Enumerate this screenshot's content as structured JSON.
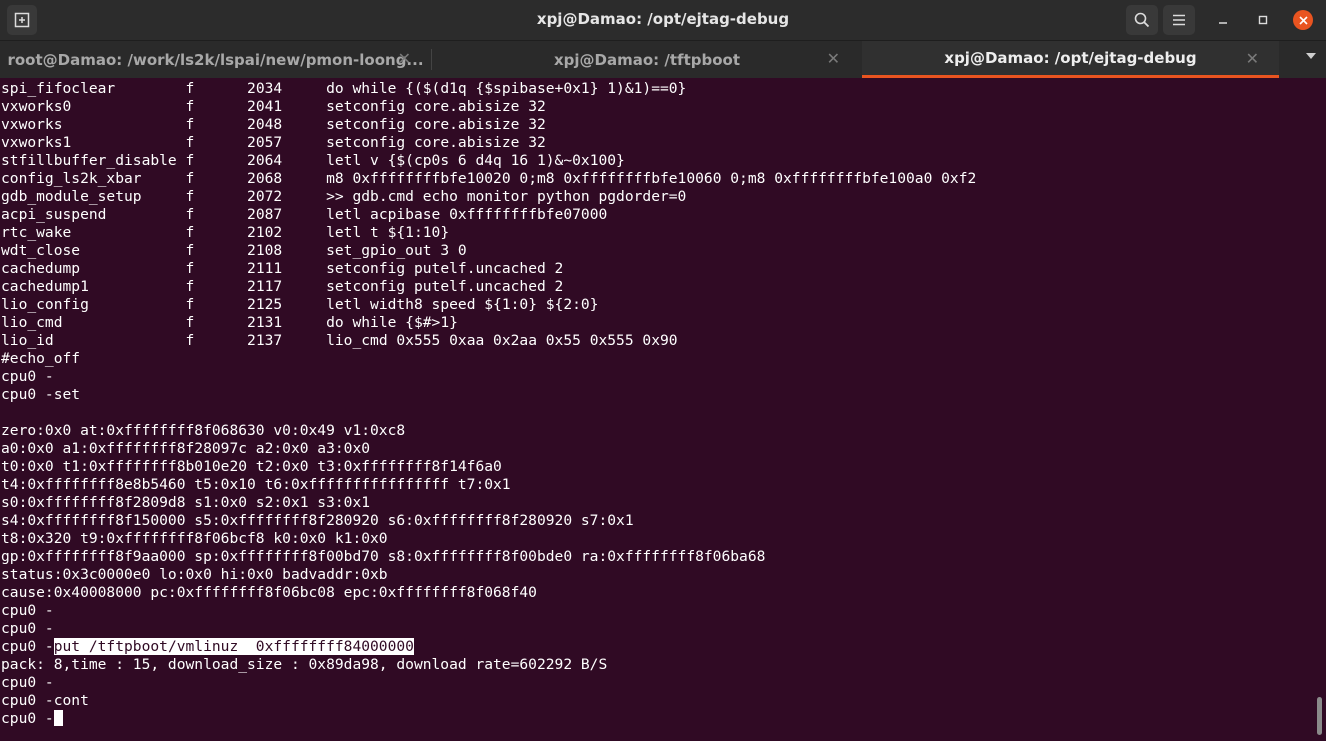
{
  "window": {
    "title": "xpj@Damao: /opt/ejtag-debug",
    "buttons": {
      "search": "search-icon",
      "menu": "hamburger-icon",
      "minimize": "minimize-icon",
      "maximize": "maximize-icon",
      "close": "close-icon"
    }
  },
  "tabs": [
    {
      "label": "root@Damao: /work/ls2k/lspai/new/pmon-loong...",
      "active": false
    },
    {
      "label": "xpj@Damao: /tftpboot",
      "active": false
    },
    {
      "label": "xpj@Damao: /opt/ejtag-debug",
      "active": true
    }
  ],
  "colors": {
    "terminal_bg": "#300a24",
    "accent": "#e95420",
    "titlebar": "#2c2c2c"
  },
  "terminal": {
    "table": [
      [
        "spi_fifoclear",
        "f",
        "2034",
        "do while {($(d1q {$spibase+0x1} 1)&1)==0}"
      ],
      [
        "vxworks0",
        "f",
        "2041",
        "setconfig core.abisize 32"
      ],
      [
        "vxworks",
        "f",
        "2048",
        "setconfig core.abisize 32"
      ],
      [
        "vxworks1",
        "f",
        "2057",
        "setconfig core.abisize 32"
      ],
      [
        "stfillbuffer_disable",
        "f",
        "2064",
        "letl v {$(cp0s 6 d4q 16 1)&~0x100}"
      ],
      [
        "config_ls2k_xbar",
        "f",
        "2068",
        "m8 0xffffffffbfe10020 0;m8 0xffffffffbfe10060 0;m8 0xffffffffbfe100a0 0xf2"
      ],
      [
        "gdb_module_setup",
        "f",
        "2072",
        ">> gdb.cmd echo monitor python pgdorder=0"
      ],
      [
        "acpi_suspend",
        "f",
        "2087",
        "letl acpibase 0xffffffffbfe07000"
      ],
      [
        "rtc_wake",
        "f",
        "2102",
        "letl t ${1:10}"
      ],
      [
        "wdt_close",
        "f",
        "2108",
        "set_gpio_out 3 0"
      ],
      [
        "cachedump",
        "f",
        "2111",
        "setconfig putelf.uncached 2"
      ],
      [
        "cachedump1",
        "f",
        "2117",
        "setconfig putelf.uncached 2"
      ],
      [
        "lio_config",
        "f",
        "2125",
        "letl width8 speed ${1:0} ${2:0}"
      ],
      [
        "lio_cmd",
        "f",
        "2131",
        "do while {$#>1}"
      ],
      [
        "lio_id",
        "f",
        "2137",
        "lio_cmd 0x555 0xaa 0x2aa 0x55 0x555 0x90"
      ]
    ],
    "lines_after_table": [
      "#echo_off",
      "cpu0 -",
      "cpu0 -set",
      "",
      "zero:0x0 at:0xffffffff8f068630 v0:0x49 v1:0xc8",
      "a0:0x0 a1:0xffffffff8f28097c a2:0x0 a3:0x0",
      "t0:0x0 t1:0xffffffff8b010e20 t2:0x0 t3:0xffffffff8f14f6a0",
      "t4:0xffffffff8e8b5460 t5:0x10 t6:0xffffffffffffffff t7:0x1",
      "s0:0xffffffff8f2809d8 s1:0x0 s2:0x1 s3:0x1",
      "s4:0xffffffff8f150000 s5:0xffffffff8f280920 s6:0xffffffff8f280920 s7:0x1",
      "t8:0x320 t9:0xffffffff8f06bcf8 k0:0x0 k1:0x0",
      "gp:0xffffffff8f9aa000 sp:0xffffffff8f00bd70 s8:0xffffffff8f00bde0 ra:0xffffffff8f06ba68",
      "status:0x3c0000e0 lo:0x0 hi:0x0 badvaddr:0xb",
      "cause:0x40008000 pc:0xffffffff8f06bc08 epc:0xffffffff8f068f40",
      "cpu0 -",
      "cpu0 -"
    ],
    "put_prompt": "cpu0 -",
    "put_command": "put /tftpboot/vmlinuz  0xffffffff84000000",
    "pack_line": "pack: 8,time : 15, download_size : 0x89da98, download rate=602292 B/S",
    "tail_lines": [
      "cpu0 -",
      "cpu0 -cont"
    ],
    "final_prompt": "cpu0 -"
  }
}
